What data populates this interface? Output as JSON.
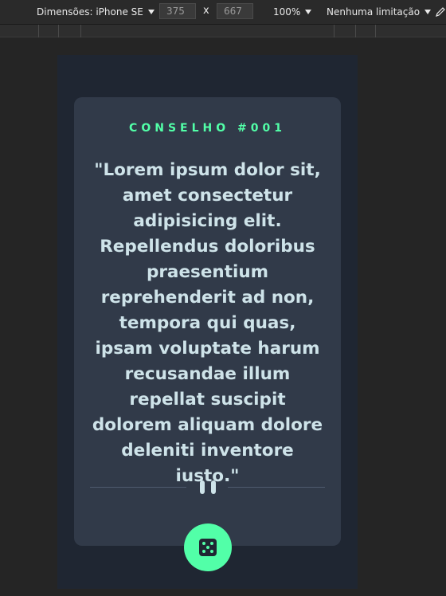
{
  "devtools": {
    "dimensions_label": "Dimensões: iPhone SE",
    "width_value": "375",
    "times": "x",
    "height_value": "667",
    "zoom": "100%",
    "throttle": "Nenhuma limitação",
    "icon": "pen-icon"
  },
  "card": {
    "advice_id": "CONSELHO #001",
    "quote": "\"Lorem ipsum dolor sit, amet consectetur adipisicing elit. Repellendus doloribus praesentium reprehenderit ad non, tempora qui quas, ipsam voluptate harum recusandae illum repellat suscipit dolorem aliquam dolore deleniti inventore iusto.\"",
    "divider_icon": "pause-icon",
    "button_icon": "dice-icon"
  },
  "colors": {
    "accent": "#52ffa8",
    "card_bg": "#313a49",
    "page_bg": "#1f2632",
    "text": "#cee3e9"
  }
}
